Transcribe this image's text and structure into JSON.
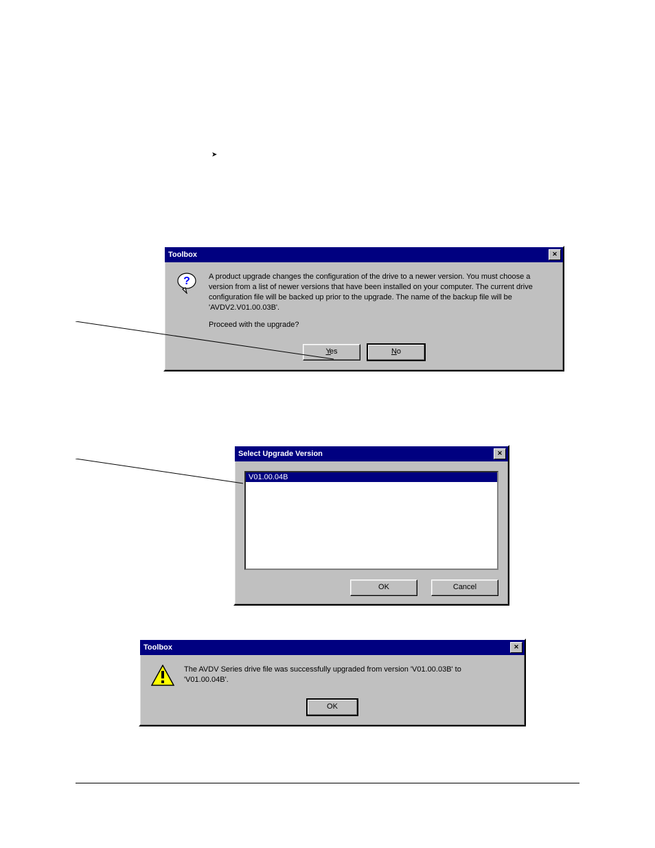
{
  "dialog1": {
    "title": "Toolbox",
    "paragraph": "A product upgrade changes the configuration of the drive to a newer version. You must choose a version from a list of newer versions that have been installed on your computer. The current drive configuration file will be backed up prior to the upgrade. The name of the backup file will be 'AVDV2.V01.00.03B'.",
    "prompt": "Proceed with the upgrade?",
    "yes": "Yes",
    "no": "No"
  },
  "dialog2": {
    "title": "Select Upgrade Version",
    "item": "V01.00.04B",
    "ok": "OK",
    "cancel": "Cancel"
  },
  "dialog3": {
    "title": "Toolbox",
    "message": "The AVDV Series drive file was successfully upgraded from version 'V01.00.03B' to 'V01.00.04B'.",
    "ok": "OK"
  },
  "arrow_bullet": "➤"
}
